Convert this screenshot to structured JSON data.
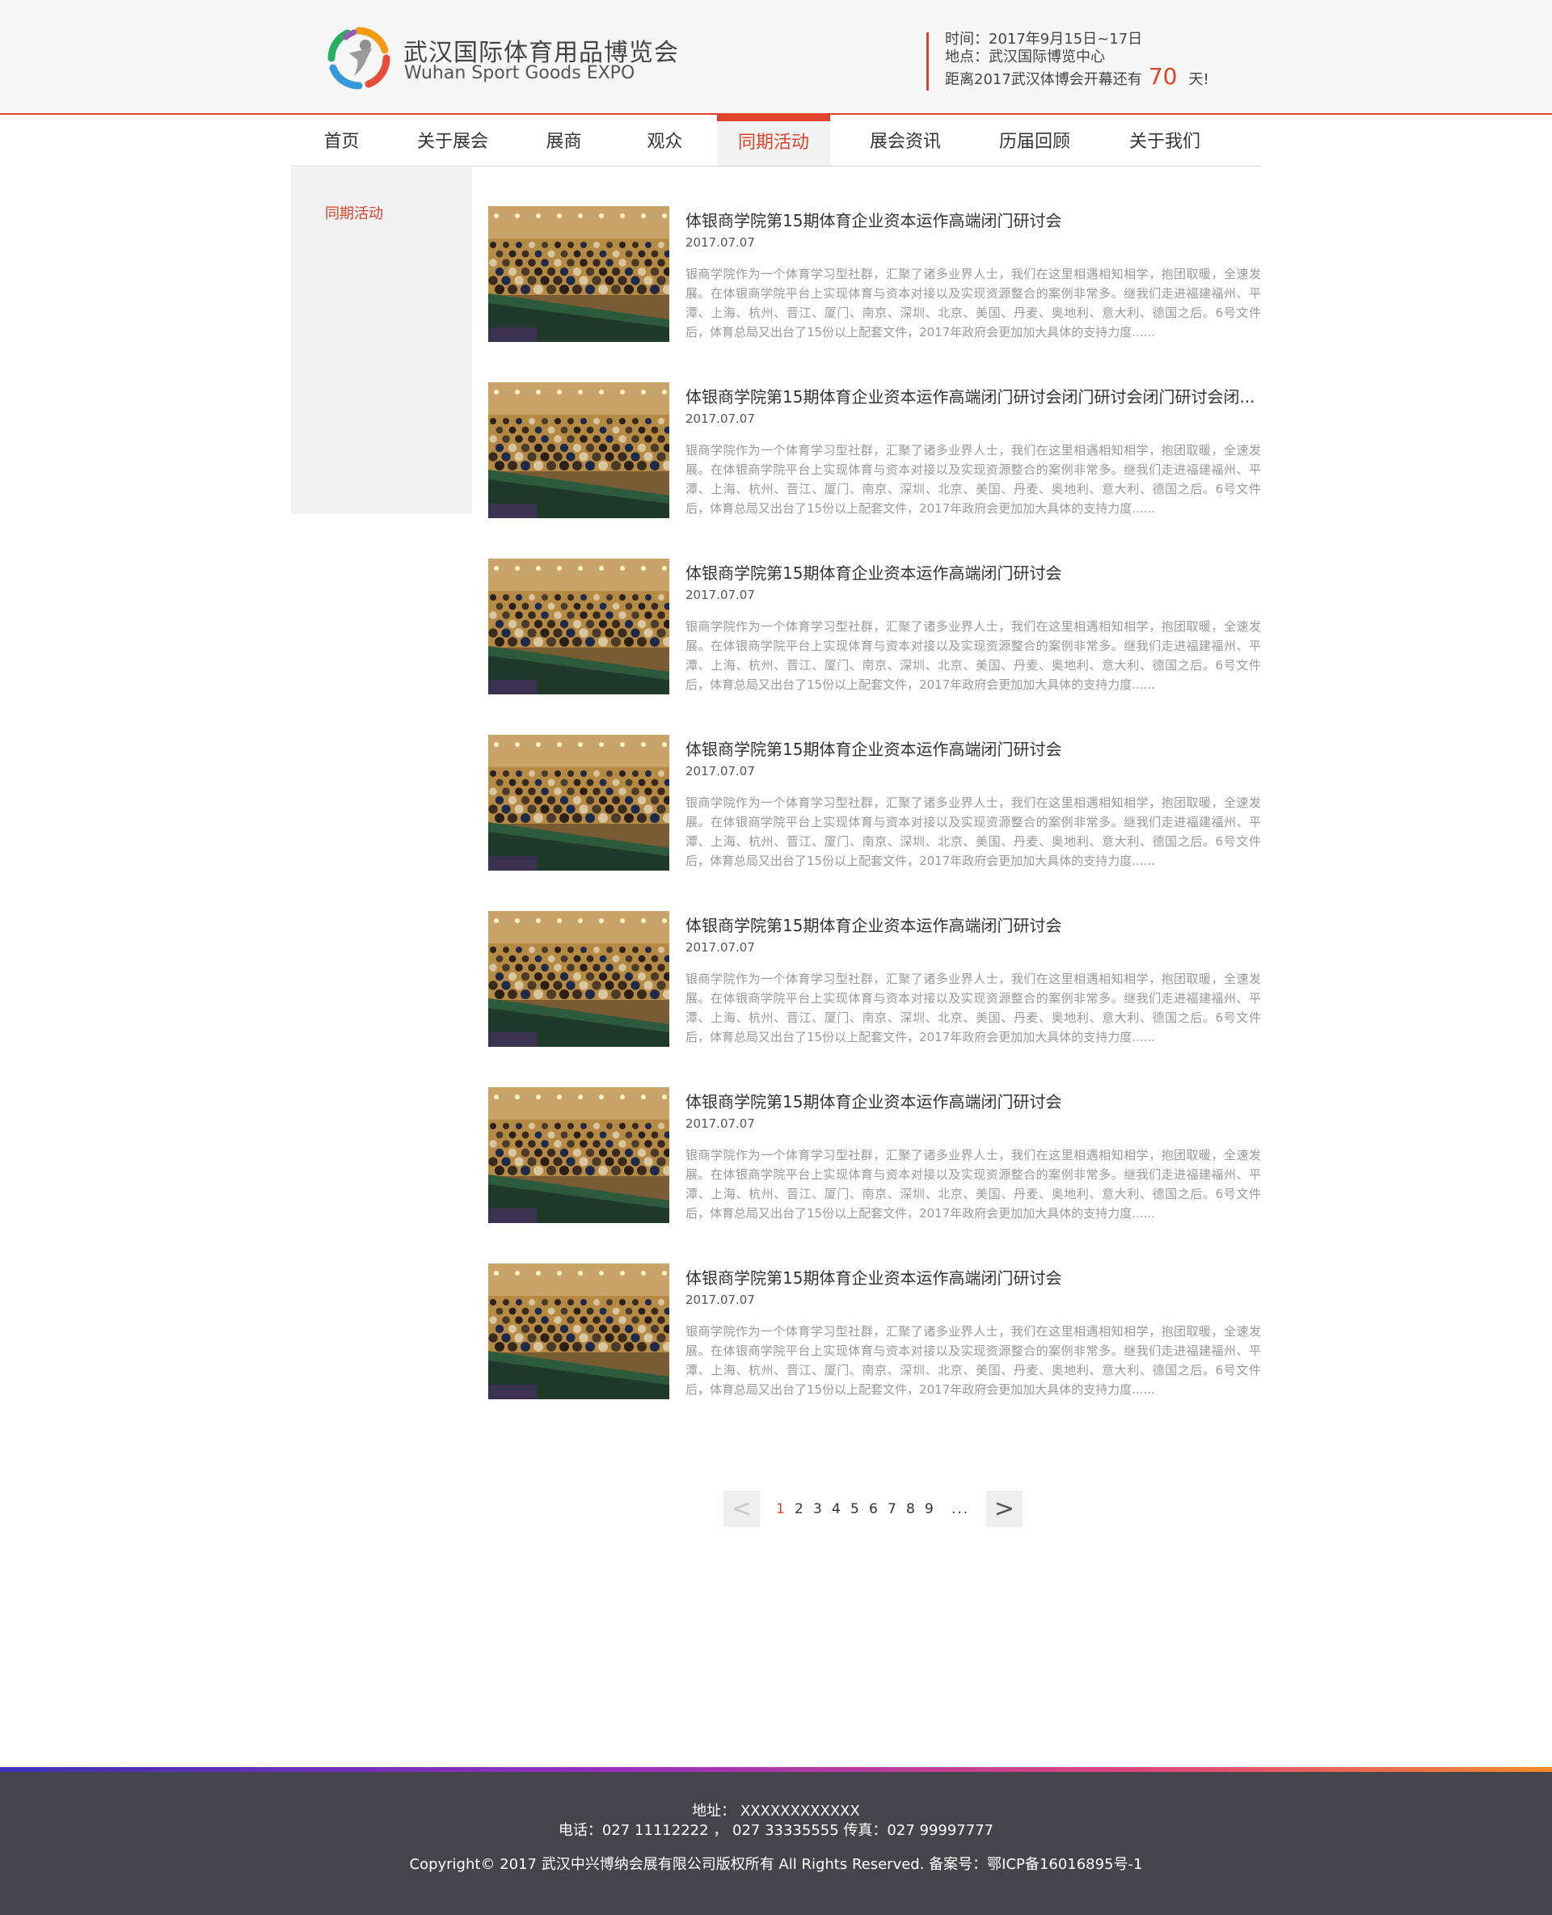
{
  "header": {
    "brand_cn": "武汉国际体育用品博览会",
    "brand_en": "Wuhan Sport Goods EXPO",
    "time": "时间：2017年9月15日~17日",
    "place": "地点：武汉国际博览中心",
    "countdown_prefix": "距离2017武汉体博会开幕还有",
    "countdown_days": "70",
    "countdown_suffix": "天!"
  },
  "nav": {
    "items": [
      {
        "label": "首页"
      },
      {
        "label": "关于展会"
      },
      {
        "label": "展商"
      },
      {
        "label": "观众"
      },
      {
        "label": "同期活动"
      },
      {
        "label": "展会资讯"
      },
      {
        "label": "历届回顾"
      },
      {
        "label": "关于我们"
      }
    ],
    "active_index": 4
  },
  "sidebar": {
    "link": "同期活动"
  },
  "articles": [
    {
      "title": "体银商学院第15期体育企业资本运作高端闭门研讨会",
      "date": "2017.07.07",
      "summary": "银商学院作为一个体育学习型社群，汇聚了诸多业界人士，我们在这里相遇相知相学，抱团取暖，全速发展。在体银商学院平台上实现体育与资本对接以及实现资源整合的案例非常多。继我们走进福建福州、平潭、上海、杭州、晋江、厦门、南京、深圳、北京、美国、丹麦、奥地利、意大利、德国之后。6号文件后，体育总局又出台了15份以上配套文件，2017年政府会更加加大具体的支持力度......"
    },
    {
      "title": "体银商学院第15期体育企业资本运作高端闭门研讨会闭门研讨会闭门研讨会闭...",
      "date": "2017.07.07",
      "summary": "银商学院作为一个体育学习型社群，汇聚了诸多业界人士，我们在这里相遇相知相学，抱团取暖，全速发展。在体银商学院平台上实现体育与资本对接以及实现资源整合的案例非常多。继我们走进福建福州、平潭、上海、杭州、晋江、厦门、南京、深圳、北京、美国、丹麦、奥地利、意大利、德国之后。6号文件后，体育总局又出台了15份以上配套文件，2017年政府会更加加大具体的支持力度......"
    },
    {
      "title": "体银商学院第15期体育企业资本运作高端闭门研讨会",
      "date": "2017.07.07",
      "summary": "银商学院作为一个体育学习型社群，汇聚了诸多业界人士，我们在这里相遇相知相学，抱团取暖，全速发展。在体银商学院平台上实现体育与资本对接以及实现资源整合的案例非常多。继我们走进福建福州、平潭、上海、杭州、晋江、厦门、南京、深圳、北京、美国、丹麦、奥地利、意大利、德国之后。6号文件后，体育总局又出台了15份以上配套文件，2017年政府会更加加大具体的支持力度......"
    },
    {
      "title": "体银商学院第15期体育企业资本运作高端闭门研讨会",
      "date": "2017.07.07",
      "summary": "银商学院作为一个体育学习型社群，汇聚了诸多业界人士，我们在这里相遇相知相学，抱团取暖，全速发展。在体银商学院平台上实现体育与资本对接以及实现资源整合的案例非常多。继我们走进福建福州、平潭、上海、杭州、晋江、厦门、南京、深圳、北京、美国、丹麦、奥地利、意大利、德国之后。6号文件后，体育总局又出台了15份以上配套文件，2017年政府会更加加大具体的支持力度......"
    },
    {
      "title": "体银商学院第15期体育企业资本运作高端闭门研讨会",
      "date": "2017.07.07",
      "summary": "银商学院作为一个体育学习型社群，汇聚了诸多业界人士，我们在这里相遇相知相学，抱团取暖，全速发展。在体银商学院平台上实现体育与资本对接以及实现资源整合的案例非常多。继我们走进福建福州、平潭、上海、杭州、晋江、厦门、南京、深圳、北京、美国、丹麦、奥地利、意大利、德国之后。6号文件后，体育总局又出台了15份以上配套文件，2017年政府会更加加大具体的支持力度......"
    },
    {
      "title": "体银商学院第15期体育企业资本运作高端闭门研讨会",
      "date": "2017.07.07",
      "summary": "银商学院作为一个体育学习型社群，汇聚了诸多业界人士，我们在这里相遇相知相学，抱团取暖，全速发展。在体银商学院平台上实现体育与资本对接以及实现资源整合的案例非常多。继我们走进福建福州、平潭、上海、杭州、晋江、厦门、南京、深圳、北京、美国、丹麦、奥地利、意大利、德国之后。6号文件后，体育总局又出台了15份以上配套文件，2017年政府会更加加大具体的支持力度......"
    },
    {
      "title": "体银商学院第15期体育企业资本运作高端闭门研讨会",
      "date": "2017.07.07",
      "summary": "银商学院作为一个体育学习型社群，汇聚了诸多业界人士，我们在这里相遇相知相学，抱团取暖，全速发展。在体银商学院平台上实现体育与资本对接以及实现资源整合的案例非常多。继我们走进福建福州、平潭、上海、杭州、晋江、厦门、南京、深圳、北京、美国、丹麦、奥地利、意大利、德国之后。6号文件后，体育总局又出台了15份以上配套文件，2017年政府会更加加大具体的支持力度......"
    }
  ],
  "pagination": {
    "prev": "<",
    "next": ">",
    "pages": [
      "1",
      "2",
      "3",
      "4",
      "5",
      "6",
      "7",
      "8",
      "9"
    ],
    "current": "1",
    "ellipsis": "..."
  },
  "footer": {
    "address": "地址：  XXXXXXXXXXXX",
    "phone": "电话：027 11112222 ，  027 33335555 传真：027 99997777",
    "copyright": "Copyright© 2017 武汉中兴博纳会展有限公司版权所有 All Rights Reserved.  备案号：鄂ICP备16016895号-1"
  },
  "colors": {
    "accent": "#e0432c",
    "footer_bg": "#45444a",
    "header_bg": "#f6f6f6"
  },
  "icons": {
    "logo": "sport-figure-ring-logo",
    "prev": "chevron-left-icon",
    "next": "chevron-right-icon"
  }
}
